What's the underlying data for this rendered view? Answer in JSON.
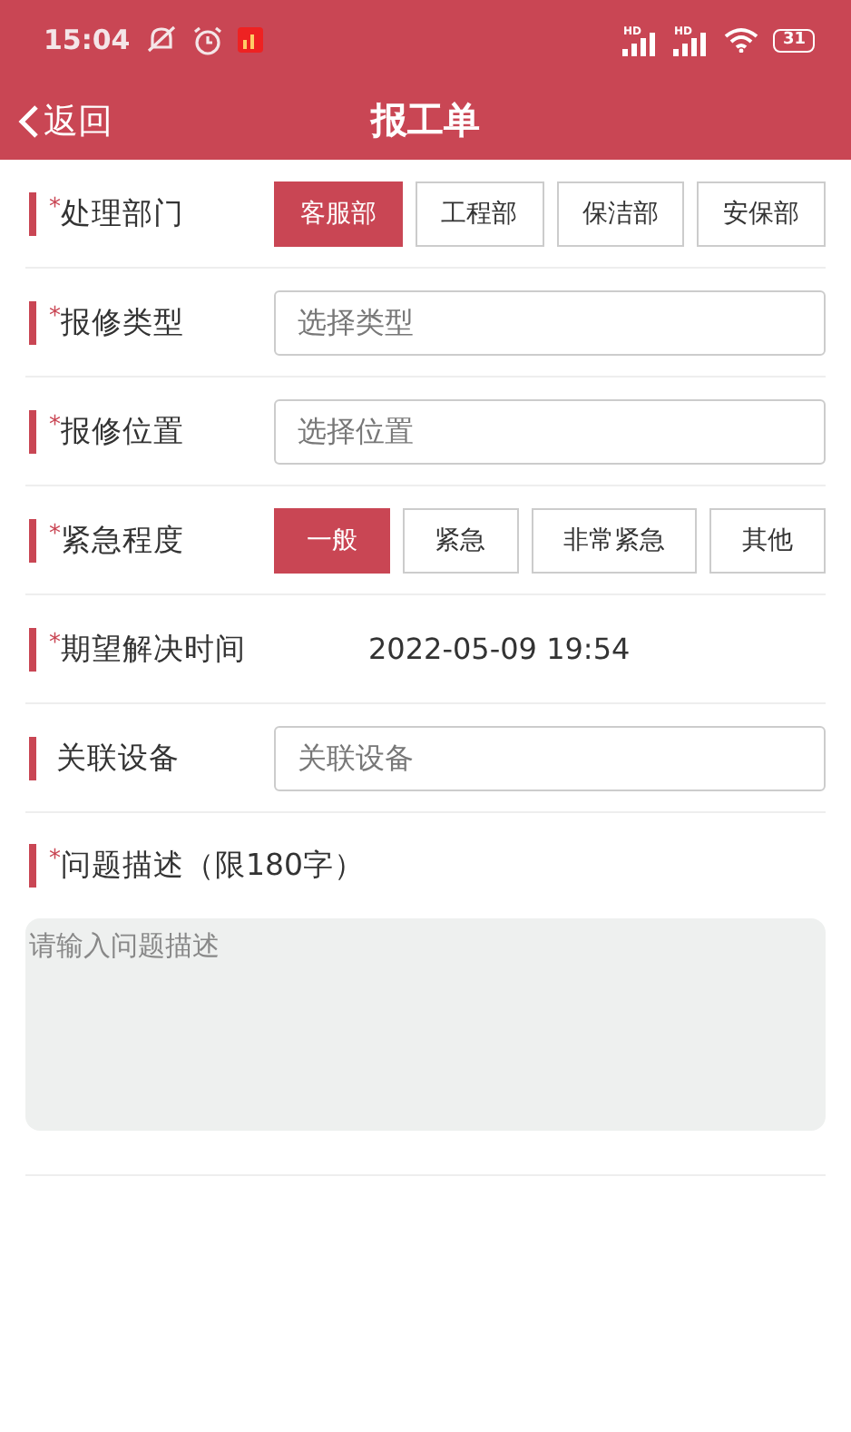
{
  "status_bar": {
    "time": "15:04",
    "signals": [
      {
        "badge": "HD"
      },
      {
        "badge": "HD"
      }
    ],
    "battery": "31"
  },
  "header": {
    "back": "返回",
    "title": "报工单"
  },
  "rows": [
    {
      "kind": "options",
      "required_mark": "*",
      "label": "处理部门",
      "options": [
        {
          "label": "客服部",
          "selected": true
        },
        {
          "label": "工程部",
          "selected": false
        },
        {
          "label": "保洁部",
          "selected": false
        },
        {
          "label": "安保部",
          "selected": false
        }
      ]
    },
    {
      "kind": "field",
      "required_mark": "*",
      "label": "报修类型",
      "placeholder": "选择类型"
    },
    {
      "kind": "field",
      "required_mark": "*",
      "label": "报修位置",
      "placeholder": "选择位置"
    },
    {
      "kind": "options",
      "required_mark": "*",
      "label": "紧急程度",
      "options": [
        {
          "label": "一般",
          "selected": true
        },
        {
          "label": "紧急",
          "selected": false
        },
        {
          "label": "非常紧急",
          "selected": false
        },
        {
          "label": "其他",
          "selected": false
        }
      ]
    },
    {
      "kind": "value",
      "required_mark": "*",
      "label": "期望解决时间",
      "value": "2022-05-09 19:54"
    },
    {
      "kind": "field",
      "label": "关联设备",
      "placeholder": "关联设备"
    }
  ],
  "description": {
    "required_mark": "*",
    "label": "问题描述（限180字）",
    "placeholder": "请输入问题描述"
  }
}
